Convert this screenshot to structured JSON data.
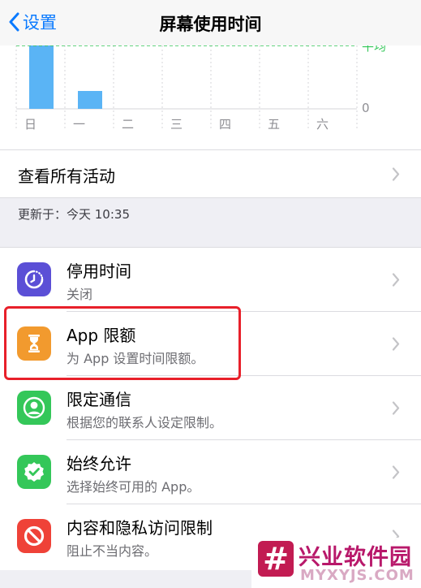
{
  "nav": {
    "back_label": "设置",
    "title": "屏幕使用时间"
  },
  "chart": {
    "avg_label": "平均",
    "zero_label": "0",
    "bar_color": "#5ab4f5",
    "avg_color": "#34c759"
  },
  "chart_data": {
    "type": "bar",
    "categories": [
      "日",
      "一",
      "二",
      "三",
      "四",
      "五",
      "六"
    ],
    "values": [
      1.0,
      0.22,
      0,
      0,
      0,
      0,
      0
    ],
    "average": 0.78,
    "ylim": [
      0,
      1.0
    ]
  },
  "all_activity": {
    "label": "查看所有活动"
  },
  "updated": "更新于：今天 10:35",
  "items": [
    {
      "title": "停用时间",
      "subtitle": "关闭",
      "icon": "downtime-icon",
      "color": "#5b4fd6"
    },
    {
      "title": "App 限额",
      "subtitle": "为 App 设置时间限额。",
      "icon": "hourglass-icon",
      "color": "#f29a2e"
    },
    {
      "title": "限定通信",
      "subtitle": "根据您的联系人设定限制。",
      "icon": "contact-icon",
      "color": "#34c759"
    },
    {
      "title": "始终允许",
      "subtitle": "选择始终可用的 App。",
      "icon": "checkmark-badge-icon",
      "color": "#34c759"
    },
    {
      "title": "内容和隐私访问限制",
      "subtitle": "阻止不当内容。",
      "icon": "restricted-icon",
      "color": "#ef4238"
    }
  ],
  "watermark": {
    "name": "兴业软件园",
    "url": "MYXYJS.COM"
  }
}
